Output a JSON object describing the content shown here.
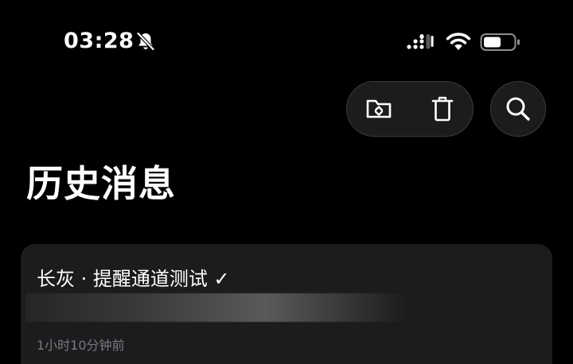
{
  "status_bar": {
    "time": "03:28",
    "icons": [
      "bell-slash-icon",
      "cellular-signal-icon",
      "wifi-icon",
      "battery-icon"
    ]
  },
  "toolbar": {
    "buttons": [
      "folder-move-icon",
      "trash-icon",
      "search-icon"
    ]
  },
  "page": {
    "title": "历史消息"
  },
  "messages": [
    {
      "title": "长灰 · 提醒通道测试 ✓",
      "time_ago": "1小时10分钟前"
    }
  ],
  "colors": {
    "background": "#000000",
    "card": "#1c1c1e",
    "button_border": "#3a3a3c",
    "secondary_text": "#7a7a7e"
  }
}
